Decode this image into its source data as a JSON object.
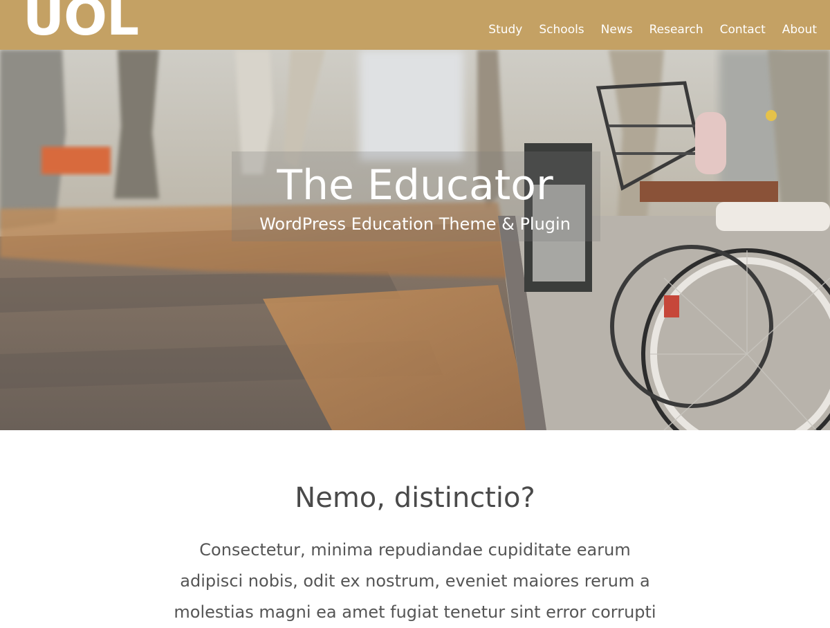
{
  "header": {
    "logo": "UOL",
    "nav": [
      "Study",
      "Schools",
      "News",
      "Research",
      "Contact",
      "About"
    ],
    "background_color": "#c4a164"
  },
  "hero": {
    "title": "The Educator",
    "subtitle": "WordPress Education Theme & Plugin",
    "image_description_icon": "autumn-bicycle-photo"
  },
  "content": {
    "heading": "Nemo, distinctio?",
    "lines": [
      "Consectetur, minima repudiandae cupiditate earum",
      "adipisci nobis, odit ex nostrum, eveniet maiores rerum a",
      "molestias magni ea amet fugiat tenetur sint error corrupti"
    ]
  }
}
